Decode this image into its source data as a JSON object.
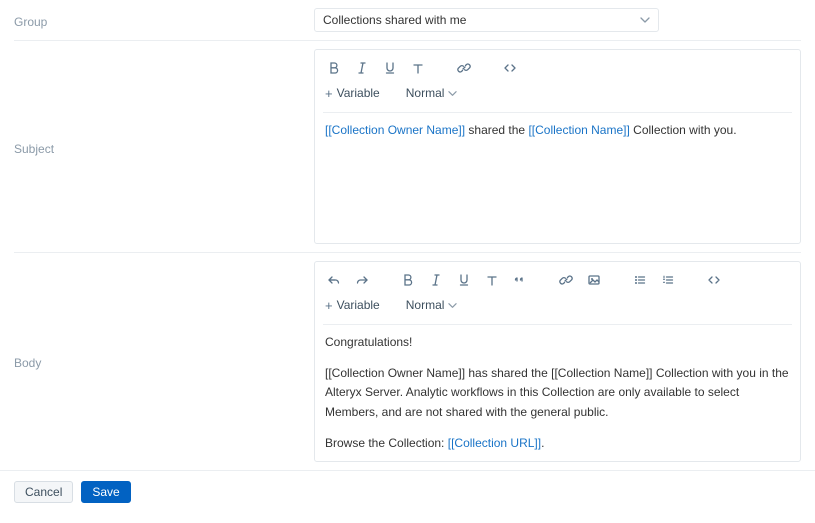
{
  "labels": {
    "group": "Group",
    "subject": "Subject",
    "body": "Body"
  },
  "group": {
    "selected": "Collections shared with me"
  },
  "toolbar": {
    "variable_label": "Variable",
    "style_label": "Normal"
  },
  "subject": {
    "tokens": {
      "owner": "[[Collection Owner Name]]",
      "sep": " shared the ",
      "name": "[[Collection Name]]",
      "tail": " Collection with you."
    }
  },
  "body": {
    "line1": "Congratulations!",
    "line2_before": "[[Collection Owner Name]] has shared the [[Collection Name]] Collection with you in the Alteryx Server. Analytic workflows in this Collection are only available to select Members, and are not shared with the general public.",
    "line3_before": "Browse the Collection: ",
    "line3_token": "[[Collection URL]]",
    "line3_after": "."
  },
  "buttons": {
    "cancel": "Cancel",
    "save": "Save"
  }
}
